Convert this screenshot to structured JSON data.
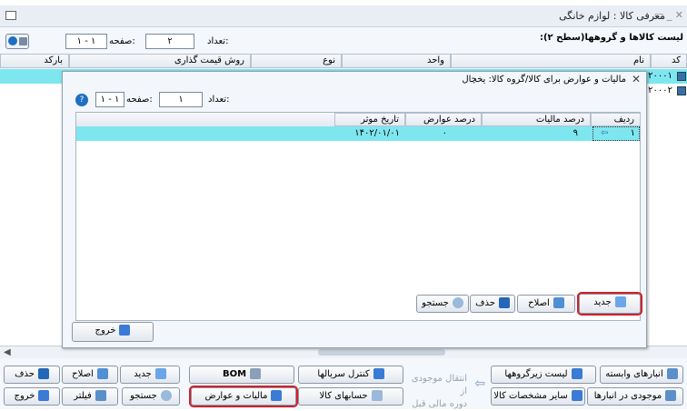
{
  "window": {
    "title": "معرفی کالا : لوازم خانگی",
    "controls": "✕ _ ▭"
  },
  "main": {
    "list_label": "لیست کالاها و گروهها(سطح ۲):",
    "count_label": "تعداد:",
    "count_value": "۲",
    "page_label": "صفحه:",
    "page_value": "۱ - ۱",
    "columns": [
      "کد",
      "نام",
      "واحد",
      "نوع",
      "روش قیمت گذاری",
      "بارکد"
    ],
    "rows": [
      {
        "code": "۲۰۰۰۱",
        "selected": true
      },
      {
        "code": "۲۰۰۰۲",
        "selected": false
      }
    ]
  },
  "dialog": {
    "title": "مالیات و عوارض برای کالا/گروه کالا:  یخچال",
    "count_label": "تعداد:",
    "count_value": "۱",
    "page_label": "صفحه:",
    "page_value": "۱ - ۱",
    "columns": [
      "ردیف",
      "درصد مالیات",
      "درصد عوارض",
      "تاریخ موثر"
    ],
    "rows": [
      {
        "row": "۱",
        "tax": "۹",
        "duty": "۰",
        "date": "۱۴۰۲/۰۱/۰۱"
      }
    ],
    "buttons": {
      "new": "جدید",
      "edit": "اصلاح",
      "delete": "حذف",
      "search": "جستجو",
      "exit": "خروج"
    }
  },
  "toolbar": {
    "row1": [
      "انبارهای وابسته",
      "لیست زیرگروهها",
      "کنترل سریالها",
      "BOM",
      "جدید",
      "اصلاح",
      "حذف"
    ],
    "row2": [
      "موجودی در انبارها",
      "سایر مشخصات کالا",
      "حسابهای کالا",
      "مالیات و عوارض",
      "جستجو",
      "فیلتر",
      "خروج"
    ],
    "transfer_line1": "انتقال موجودی از",
    "transfer_line2": "دوره مالی قبل"
  },
  "colors": {
    "highlight_row": "#7ee6ef",
    "highlight_red": "#d0202a",
    "accent": "#1f6fc2"
  }
}
